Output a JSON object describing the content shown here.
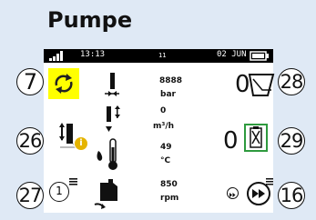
{
  "title": "Pumpe",
  "statusbar": {
    "time": "13:13",
    "channel": "11",
    "date": "02 JUN"
  },
  "callouts": {
    "c7": "7",
    "c26": "26",
    "c27": "27",
    "c28": "28",
    "c29": "29",
    "c16": "16"
  },
  "readings": {
    "pressure_value": "8888",
    "pressure_unit": "bar",
    "flow_value": "0",
    "flow_unit": "m³/h",
    "temperature_value": "49",
    "temperature_unit": "°C",
    "speed_value": "850",
    "speed_unit": "rpm"
  },
  "right_values": {
    "count_top": "0",
    "count_mid": "0"
  },
  "mode_number": "1",
  "colors": {
    "auto_highlight": "#ffff00",
    "selected_box": "#2e9a3e",
    "background": "#dfe9f5"
  },
  "icons": [
    "signal-icon",
    "auto-mode-icon",
    "pressure-icon",
    "flow-icon",
    "info-icon",
    "temperature-icon",
    "motor-speed-icon",
    "curve-icon",
    "pump-check-icon",
    "fast-forward-icon",
    "menu-icon"
  ]
}
